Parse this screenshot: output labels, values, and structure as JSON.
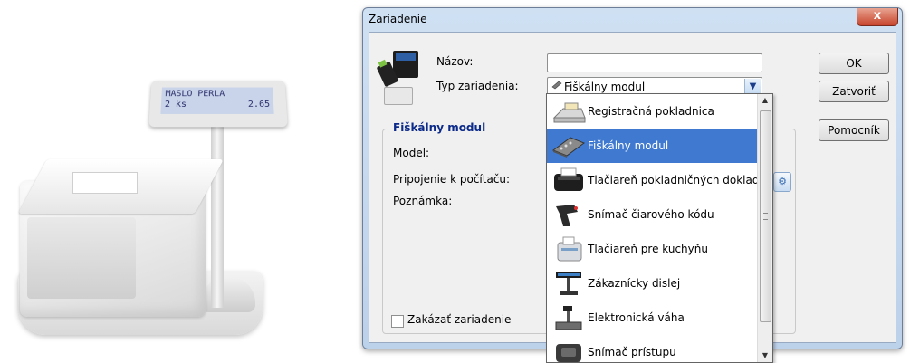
{
  "photo": {
    "lcd_line1": "MASLO PERLA",
    "lcd_line2_left": "2 ks",
    "lcd_line2_right": "2.65"
  },
  "dialog": {
    "title": "Zariadenie",
    "close_label": "x",
    "nazov_label": "Názov:",
    "nazov_value": "",
    "typ_label": "Typ zariadenia:",
    "typ_value": "Fiškálny modul",
    "group_title": "Fiškálny modul",
    "model_label": "Model:",
    "pripojenie_label": "Pripojenie k počítaču:",
    "poznamka_label": "Poznámka:",
    "zakazat_label": "Zakázať zariadenie",
    "zakazat_checked": false,
    "buttons": {
      "ok": "OK",
      "zatvorit": "Zatvoriť",
      "pomocnik": "Pomocník"
    }
  },
  "dropdown": {
    "items": [
      {
        "label": "Registračná pokladnica",
        "icon": "cash-register-icon"
      },
      {
        "label": "Fiškálny modul",
        "icon": "fiscal-module-icon",
        "selected": true
      },
      {
        "label": "Tlačiareň pokladničných dokladov",
        "icon": "receipt-printer-icon"
      },
      {
        "label": "Snímač čiarového kódu",
        "icon": "barcode-scanner-icon"
      },
      {
        "label": "Tlačiareň pre kuchyňu",
        "icon": "kitchen-printer-icon"
      },
      {
        "label": "Zákaznícky dislej",
        "icon": "customer-display-icon"
      },
      {
        "label": "Elektronická váha",
        "icon": "scale-icon"
      },
      {
        "label": "Snímač prístupu",
        "icon": "access-reader-icon"
      }
    ]
  }
}
